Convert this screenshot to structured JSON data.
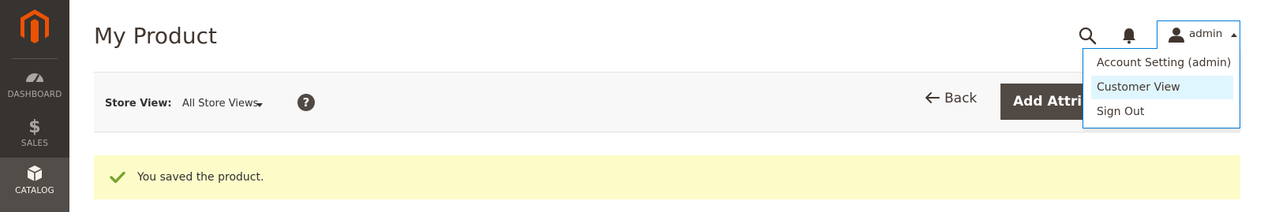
{
  "sidebar": {
    "logo_name": "magento-logo",
    "items": [
      {
        "label": "DASHBOARD",
        "icon": "dashboard-gauge-icon"
      },
      {
        "label": "SALES",
        "icon": "dollar-icon"
      },
      {
        "label": "CATALOG",
        "icon": "cube-icon",
        "active": true
      }
    ]
  },
  "header": {
    "title": "My Product",
    "user_name": "admin"
  },
  "account_menu": {
    "items": [
      {
        "label": "Account Setting (admin)"
      },
      {
        "label": "Customer View",
        "highlighted": true
      },
      {
        "label": "Sign Out"
      }
    ]
  },
  "action_bar": {
    "store_label": "Store View:",
    "store_value": "All Store Views",
    "help_icon_text": "?",
    "back_label": "Back",
    "add_attribute_label": "Add Attribute"
  },
  "message": {
    "text": "You saved the product."
  },
  "colors": {
    "sidebar_bg": "#373330",
    "sidebar_active": "#524d49",
    "logo_orange": "#eb5202",
    "primary_button": "#514943",
    "focus_border": "#007bdb",
    "menu_hover": "#e0f6fe",
    "success_bg": "#fdfcc9",
    "success_check": "#79a22e"
  }
}
